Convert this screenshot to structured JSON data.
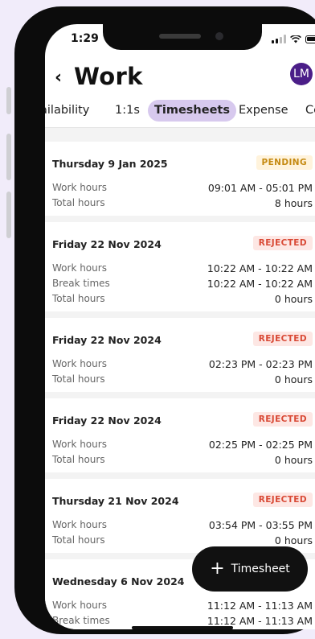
{
  "status_bar": {
    "time": "1:29"
  },
  "header": {
    "back": "‹",
    "title": "Work",
    "avatar_initials": "LM"
  },
  "tabs": [
    {
      "label": "ailability",
      "active": false
    },
    {
      "label": "1:1s",
      "active": false
    },
    {
      "label": "Timesheets",
      "active": true
    },
    {
      "label": "Expense",
      "active": false
    },
    {
      "label": "Ce",
      "active": false
    }
  ],
  "timesheets": [
    {
      "date": "Thursday 9 Jan 2025",
      "status": "PENDING",
      "rows": [
        {
          "label": "Work hours",
          "value": "09:01 AM - 05:01 PM"
        },
        {
          "label": "Total hours",
          "value": "8 hours"
        }
      ]
    },
    {
      "date": "Friday 22 Nov 2024",
      "status": "REJECTED",
      "rows": [
        {
          "label": "Work hours",
          "value": "10:22 AM - 10:22 AM"
        },
        {
          "label": "Break times",
          "value": "10:22 AM - 10:22 AM"
        },
        {
          "label": "Total hours",
          "value": "0 hours"
        }
      ]
    },
    {
      "date": "Friday 22 Nov 2024",
      "status": "REJECTED",
      "rows": [
        {
          "label": "Work hours",
          "value": "02:23 PM - 02:23 PM"
        },
        {
          "label": "Total hours",
          "value": "0 hours"
        }
      ]
    },
    {
      "date": "Friday 22 Nov 2024",
      "status": "REJECTED",
      "rows": [
        {
          "label": "Work hours",
          "value": "02:25 PM - 02:25 PM"
        },
        {
          "label": "Total hours",
          "value": "0 hours"
        }
      ]
    },
    {
      "date": "Thursday 21 Nov 2024",
      "status": "REJECTED",
      "rows": [
        {
          "label": "Work hours",
          "value": "03:54 PM - 03:55 PM"
        },
        {
          "label": "Total hours",
          "value": "0 hours"
        }
      ]
    },
    {
      "date": "Wednesday 6 Nov 2024",
      "status": "",
      "rows": [
        {
          "label": "Work hours",
          "value": "11:12 AM - 11:13 AM"
        },
        {
          "label": "Break times",
          "value": "11:12 AM - 11:13 AM"
        }
      ]
    }
  ],
  "fab": {
    "icon": "+",
    "label": "Timesheet"
  },
  "colors": {
    "background": "#f1ecfa",
    "accent": "#d7c9ee",
    "avatar": "#4b1e88",
    "pending_text": "#c58a12",
    "rejected_text": "#d94a36"
  },
  "icons": [
    "back-chevron-icon",
    "signal-icon",
    "wifi-icon",
    "battery-icon",
    "plus-icon"
  ]
}
